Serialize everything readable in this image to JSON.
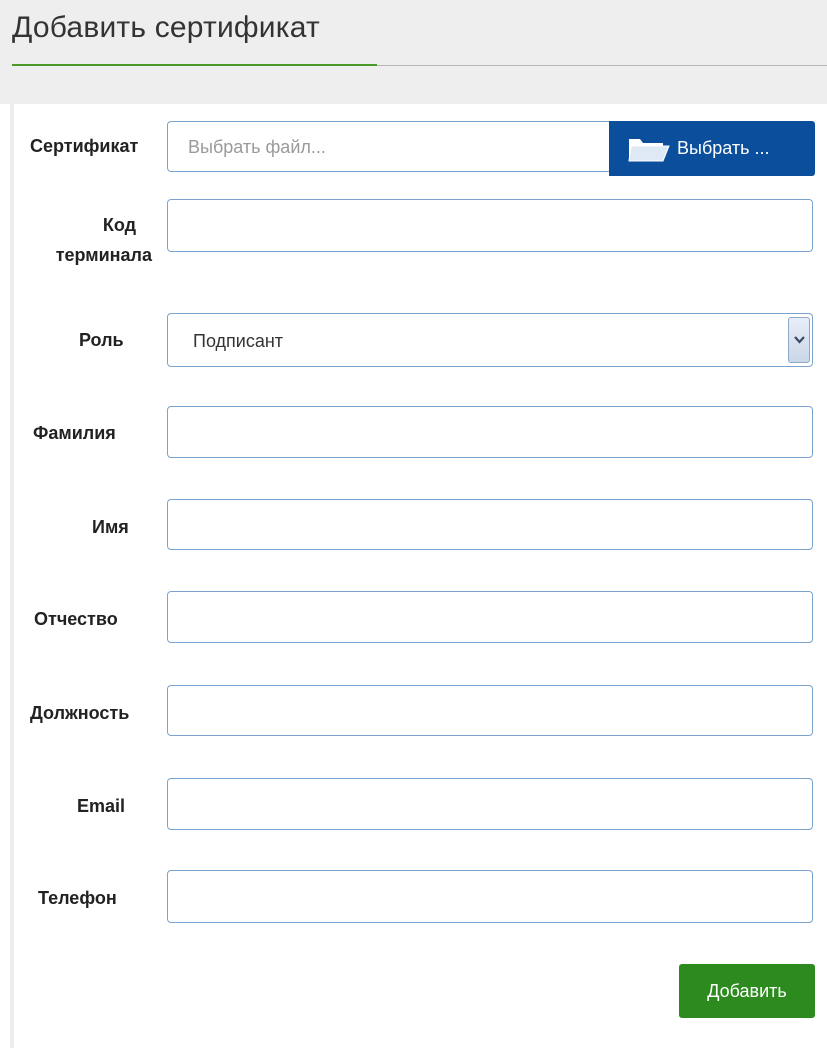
{
  "page": {
    "title": "Добавить сертификат"
  },
  "form": {
    "certificate": {
      "label": "Сертификат",
      "placeholder": "Выбрать файл...",
      "browse_label": "Выбрать ...",
      "browse_icon": "folder-open-icon"
    },
    "terminal_code": {
      "label_line1": "Код",
      "label_line2": "терминала",
      "value": ""
    },
    "role": {
      "label": "Роль",
      "selected": "Подписант",
      "arrow_icon": "chevron-down-icon"
    },
    "last_name": {
      "label": "Фамилия",
      "value": ""
    },
    "first_name": {
      "label": "Имя",
      "value": ""
    },
    "patronymic": {
      "label": "Отчество",
      "value": ""
    },
    "position": {
      "label": "Должность",
      "value": ""
    },
    "email": {
      "label": "Email",
      "value": ""
    },
    "phone": {
      "label": "Телефон",
      "value": ""
    },
    "submit_label": "Добавить"
  },
  "colors": {
    "accent_green": "#2c8a1f",
    "accent_blue": "#0b4f9c",
    "input_border": "#7aa4cf"
  }
}
